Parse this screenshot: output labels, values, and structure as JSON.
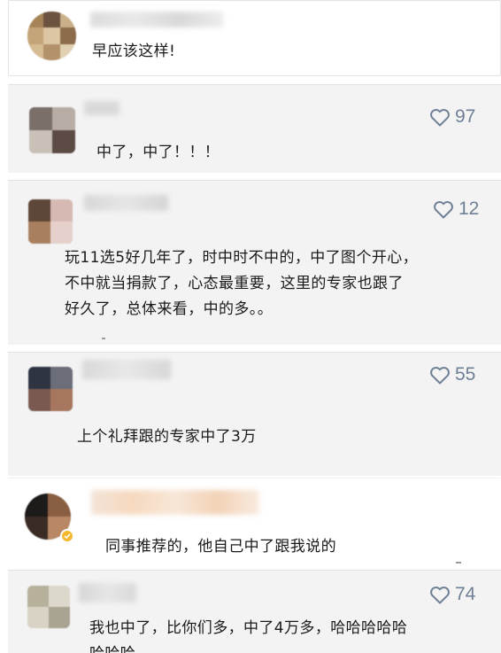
{
  "comments": [
    {
      "id": "c1",
      "text_lines": [
        "早应该这样!"
      ],
      "likes": null
    },
    {
      "id": "c2",
      "text_lines": [
        "中了，中了！！！"
      ],
      "likes": "97"
    },
    {
      "id": "c3",
      "text_lines": [
        "玩11选5好几年了，时中时不中的，中了图个开心，",
        "不中就当捐款了，心态最重要，这里的专家也跟了",
        "好久了，总体来看，中的多。。"
      ],
      "likes": "12"
    },
    {
      "id": "c4",
      "text_lines": [
        "上个礼拜跟的专家中了3万"
      ],
      "likes": "55"
    },
    {
      "id": "c5",
      "text_lines": [
        "同事推荐的，他自己中了跟我说的"
      ],
      "likes": null
    },
    {
      "id": "c6",
      "text_lines": [
        "我也中了，比你们多，中了4万多，哈哈哈哈哈",
        "哈哈哈"
      ],
      "likes": "74"
    }
  ],
  "icons": {
    "like": "heart-outline-icon",
    "verified": "verified-check-icon"
  },
  "colors": {
    "like": "#6f7f95",
    "card_grey": "#f3f3f3",
    "verified": "#f5b82e"
  }
}
